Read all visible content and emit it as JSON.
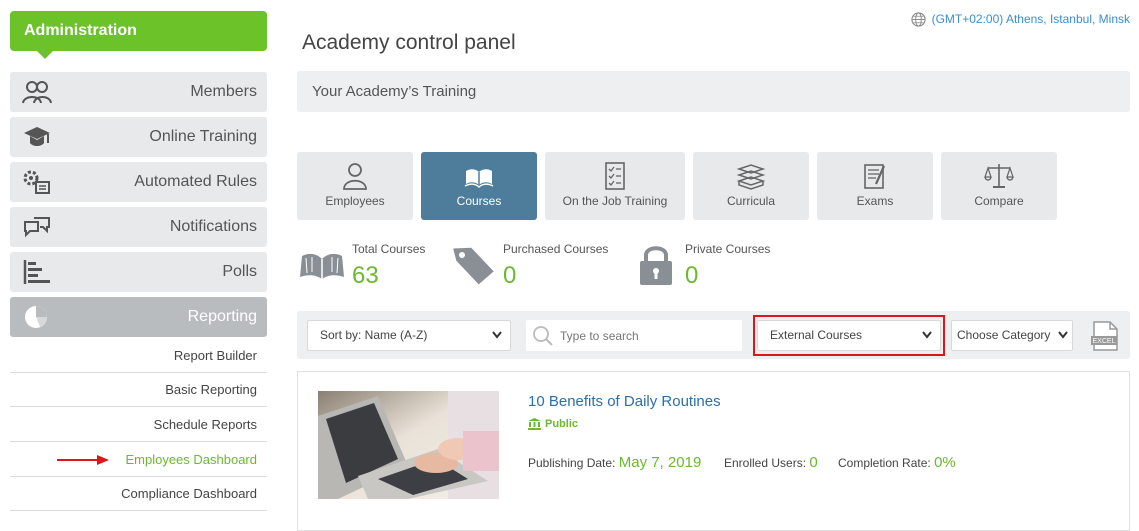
{
  "sidebar": {
    "header": "Administration",
    "items": [
      {
        "label": "Members",
        "icon": "members-icon"
      },
      {
        "label": "Online Training",
        "icon": "graduation-cap-icon"
      },
      {
        "label": "Automated Rules",
        "icon": "gears-icon"
      },
      {
        "label": "Notifications",
        "icon": "chat-bubbles-icon"
      },
      {
        "label": "Polls",
        "icon": "bar-chart-icon"
      },
      {
        "label": "Reporting",
        "icon": "pie-chart-icon"
      }
    ],
    "subitems": [
      {
        "label": "Report Builder"
      },
      {
        "label": "Basic Reporting"
      },
      {
        "label": "Schedule Reports"
      },
      {
        "label": "Employees Dashboard"
      },
      {
        "label": "Compliance Dashboard"
      }
    ]
  },
  "timezone": "(GMT+02:00) Athens, Istanbul, Minsk",
  "page_title": "Academy control panel",
  "training_bar": "Your Academy’s Training",
  "tabs": [
    {
      "label": "Employees",
      "icon": "person-icon"
    },
    {
      "label": "Courses",
      "icon": "open-book-icon"
    },
    {
      "label": "On the Job Training",
      "icon": "checklist-icon"
    },
    {
      "label": "Curricula",
      "icon": "book-stack-icon"
    },
    {
      "label": "Exams",
      "icon": "exam-icon"
    },
    {
      "label": "Compare",
      "icon": "scales-icon"
    }
  ],
  "stats": [
    {
      "label": "Total Courses",
      "value": "63"
    },
    {
      "label": "Purchased Courses",
      "value": "0"
    },
    {
      "label": "Private Courses",
      "value": "0"
    }
  ],
  "filters": {
    "sort": "Sort by: Name (A-Z)",
    "search_placeholder": "Type to search",
    "course_type": "External Courses",
    "category": "Choose Category",
    "excel_label": "EXCEL"
  },
  "course": {
    "title": "10 Benefits of Daily Routines",
    "visibility": "Public",
    "publishing_label": "Publishing Date:",
    "publishing_date": "May 7, 2019",
    "enrolled_label": "Enrolled Users:",
    "enrolled": "0",
    "completion_label": "Completion Rate:",
    "completion": "0%"
  },
  "colors": {
    "green": "#6cc329",
    "active_tab": "#4e7d9b",
    "highlight_border": "#e0151c",
    "link": "#2e6ea8"
  }
}
